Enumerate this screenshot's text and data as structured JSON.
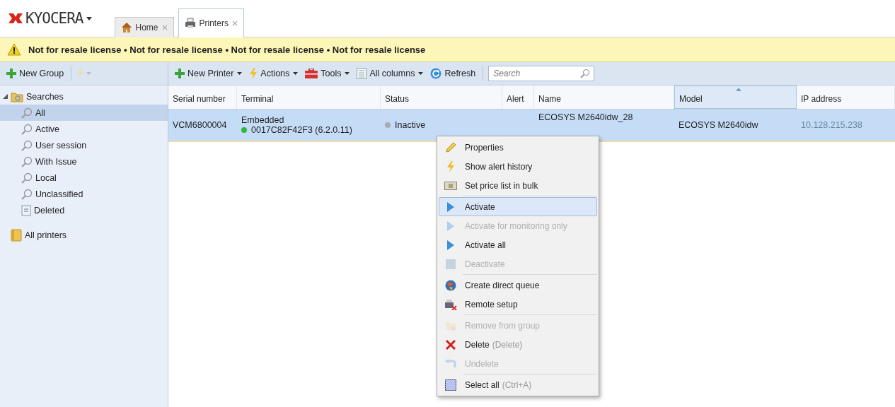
{
  "header": {
    "logo": "KYOCERA",
    "tabs": [
      {
        "label": "Home",
        "kind": "home",
        "selected": false
      },
      {
        "label": "Printers",
        "kind": "printers",
        "selected": true
      }
    ]
  },
  "banner": {
    "text": "Not for resale license • Not for resale license • Not for resale license • Not for resale license"
  },
  "left_toolbar": {
    "new_group": "New Group"
  },
  "toolbar": {
    "buttons": [
      {
        "label": "New Printer",
        "kind": "add"
      },
      {
        "label": "Actions",
        "kind": "actions"
      },
      {
        "label": "Tools",
        "kind": "tools"
      },
      {
        "label": "All columns",
        "kind": "columns"
      },
      {
        "label": "Refresh",
        "kind": "refresh"
      }
    ],
    "search": {
      "placeholder": "Search"
    }
  },
  "sidebar": {
    "items": [
      {
        "label": "Searches",
        "kind": "folder",
        "expanded": true,
        "selected": false,
        "children": [
          {
            "label": "All",
            "kind": "search",
            "selected": true
          },
          {
            "label": "Active",
            "kind": "search",
            "selected": false
          },
          {
            "label": "User session",
            "kind": "search",
            "selected": false
          },
          {
            "label": "With Issue",
            "kind": "search",
            "selected": false
          },
          {
            "label": "Local",
            "kind": "search",
            "selected": false
          },
          {
            "label": "Unclassified",
            "kind": "search",
            "selected": false
          },
          {
            "label": "Deleted",
            "kind": "trash",
            "selected": false
          }
        ]
      },
      {
        "label": "All printers",
        "kind": "book",
        "selected": false
      }
    ]
  },
  "table": {
    "columns": [
      {
        "label": "Serial number",
        "sorted": false
      },
      {
        "label": "Terminal",
        "sorted": false
      },
      {
        "label": "Status",
        "sorted": false
      },
      {
        "label": "Alert",
        "sorted": false
      },
      {
        "label": "Name",
        "sorted": false
      },
      {
        "label": "Model",
        "sorted": true
      },
      {
        "label": "IP address",
        "sorted": false
      }
    ],
    "rows": [
      {
        "selected": true,
        "serial": "VCM6800004",
        "terminal_type": "Embedded",
        "terminal_id": "0017C82F42F3 (6.2.0.11)",
        "terminal_online": true,
        "status": "Inactive",
        "active": false,
        "name": "ECOSYS M2640idw_28",
        "model": "ECOSYS M2640idw",
        "ip": "10.128.215.238"
      }
    ]
  },
  "context_menu": {
    "groups": [
      [
        {
          "label": "Properties",
          "kind": "pencil",
          "disabled": false,
          "selected": false
        },
        {
          "label": "Show alert history",
          "kind": "bolt",
          "disabled": false,
          "selected": false
        },
        {
          "label": "Set price list in bulk",
          "kind": "money",
          "disabled": false,
          "selected": false
        }
      ],
      [
        {
          "label": "Activate",
          "kind": "play",
          "disabled": false,
          "selected": true
        },
        {
          "label": "Activate for monitoring only",
          "kind": "play",
          "disabled": true,
          "selected": false
        },
        {
          "label": "Activate all",
          "kind": "play",
          "disabled": false,
          "selected": false
        },
        {
          "label": "Deactivate",
          "kind": "stop",
          "disabled": true,
          "selected": false
        }
      ],
      [
        {
          "label": "Create direct queue",
          "kind": "globe",
          "disabled": false,
          "selected": false
        },
        {
          "label": "Remote setup",
          "kind": "remote",
          "disabled": false,
          "selected": false
        }
      ],
      [
        {
          "label": "Remove from group",
          "kind": "remove",
          "disabled": true,
          "selected": false
        },
        {
          "label": "Delete",
          "shortcut": "(Delete)",
          "kind": "delete",
          "disabled": false,
          "selected": false
        },
        {
          "label": "Undelete",
          "kind": "undo",
          "disabled": true,
          "selected": false
        }
      ],
      [
        {
          "label": "Select all",
          "shortcut": "(Ctrl+A)",
          "kind": "select",
          "disabled": false,
          "selected": false
        }
      ]
    ]
  }
}
